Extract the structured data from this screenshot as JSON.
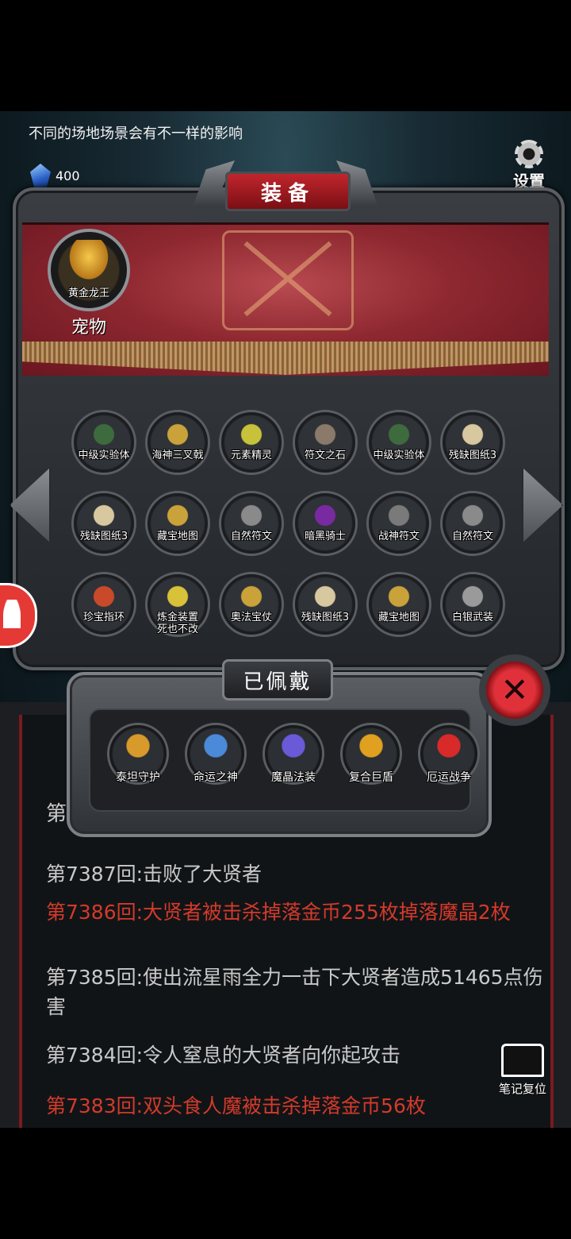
{
  "hint_text": "不同的场地场景会有不一样的影响",
  "gem_count": "400",
  "settings_label": "设置",
  "panel_title": "装备",
  "pet": {
    "name": "黄金龙王",
    "label": "宠物"
  },
  "items": [
    {
      "label": "中级实验体",
      "color": "#3d6b3d"
    },
    {
      "label": "海神三叉戟",
      "color": "#c9a23a"
    },
    {
      "label": "元素精灵",
      "color": "#c8c23a"
    },
    {
      "label": "符文之石",
      "color": "#8a7a6a"
    },
    {
      "label": "中级实验体",
      "color": "#3d6b3d"
    },
    {
      "label": "残缺图纸3",
      "color": "#d8c8a0"
    },
    {
      "label": "残缺图纸3",
      "color": "#d8c8a0"
    },
    {
      "label": "藏宝地图",
      "color": "#c9a23a"
    },
    {
      "label": "自然符文",
      "color": "#8a8a8a"
    },
    {
      "label": "暗黑骑士",
      "color": "#7a2aa0"
    },
    {
      "label": "战神符文",
      "color": "#7a7a7a"
    },
    {
      "label": "自然符文",
      "color": "#8a8a8a"
    },
    {
      "label": "珍宝指环",
      "color": "#c84a2a"
    },
    {
      "label": "炼金装置\n死也不改",
      "color": "#d8c23a"
    },
    {
      "label": "奥法宝仗",
      "color": "#c9a23a"
    },
    {
      "label": "残缺图纸3",
      "color": "#d8c8a0"
    },
    {
      "label": "藏宝地图",
      "color": "#c9a23a"
    },
    {
      "label": "白银武装",
      "color": "#9a9a9a"
    }
  ],
  "worn_title": "已佩戴",
  "worn_items": [
    {
      "label": "泰坦守护",
      "color": "#d89a2a"
    },
    {
      "label": "命运之神",
      "color": "#4a8ad8"
    },
    {
      "label": "魔晶法装",
      "color": "#6a5ad8"
    },
    {
      "label": "复合巨盾",
      "color": "#e0a020"
    },
    {
      "label": "厄运战争",
      "color": "#d82a2a"
    }
  ],
  "log_partial": "第",
  "log": [
    {
      "text": "第7387回:击败了大贤者",
      "type": "grey"
    },
    {
      "text": "第7386回:大贤者被击杀掉落金币255枚掉落魔晶2枚",
      "type": "red"
    },
    {
      "text": "第7385回:使出流星雨全力一击下大贤者造成51465点伤害",
      "type": "grey"
    },
    {
      "text": "第7384回:令人窒息的大贤者向你起攻击",
      "type": "grey"
    },
    {
      "text": "第7383回:双头食人魔被击杀掉落金币56枚",
      "type": "red"
    }
  ],
  "close_label": "✕",
  "note_reset_label": "笔记复位"
}
